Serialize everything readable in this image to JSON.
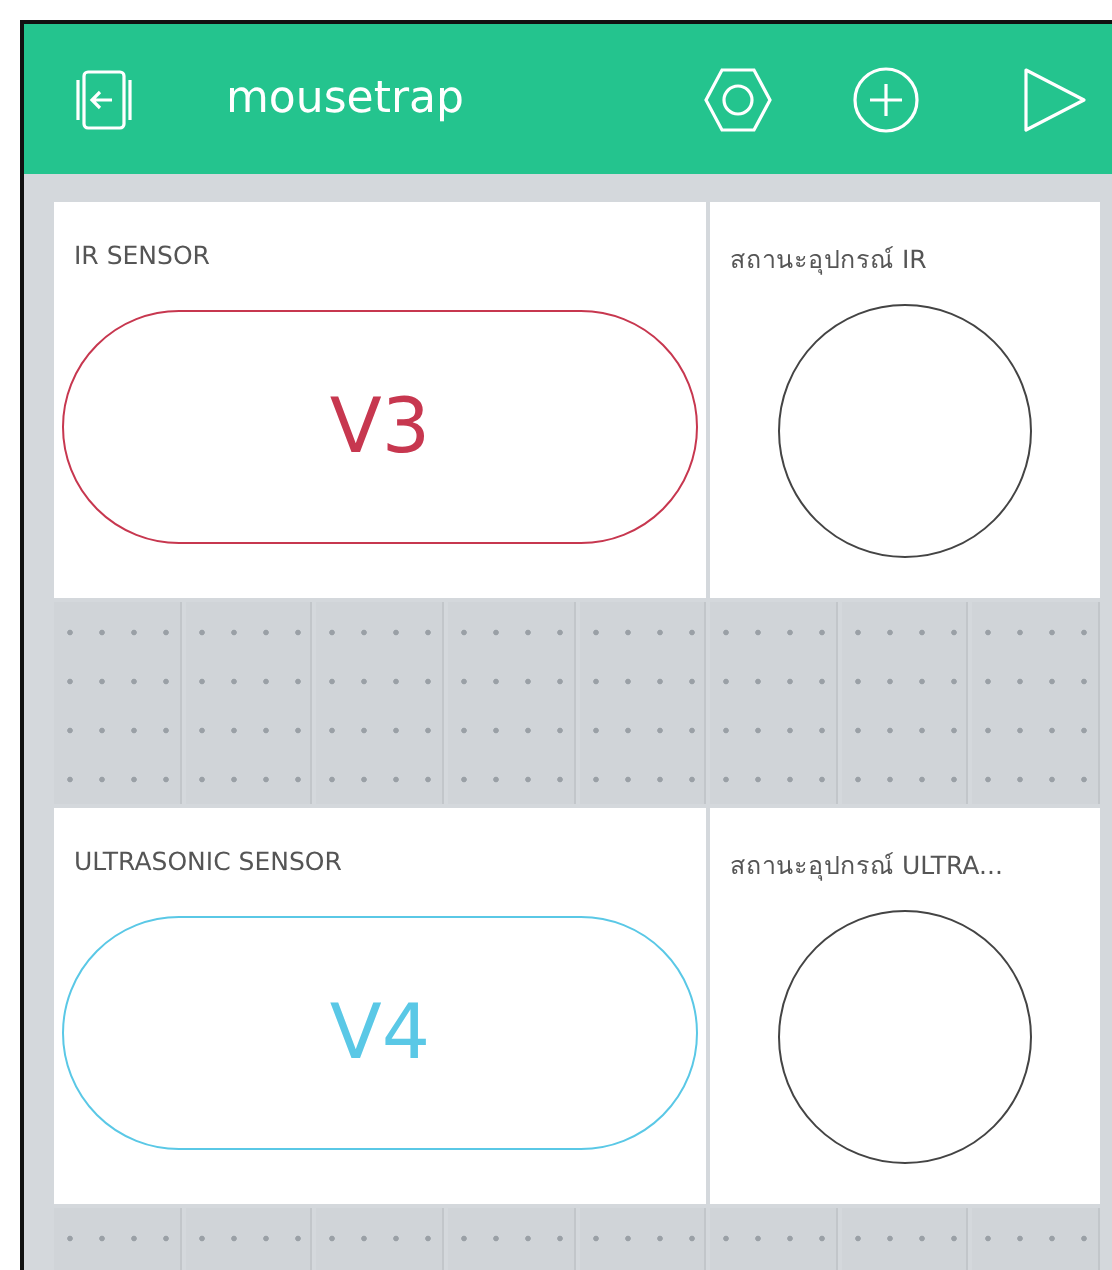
{
  "app": {
    "title": "mousetrap"
  },
  "dashboard": [
    {
      "widgets": [
        {
          "kind": "button",
          "title": "IR SENSOR",
          "label": "V3",
          "color": "#c7374f"
        },
        {
          "kind": "led",
          "title": "สถานะอุปกรณ์ IR"
        }
      ]
    },
    {
      "widgets": [
        {
          "kind": "button",
          "title": "ULTRASONIC SENSOR",
          "label": "V4",
          "color": "#5ac8e6"
        },
        {
          "kind": "led",
          "title": "สถานะอุปกรณ์ ULTRA..."
        }
      ]
    }
  ]
}
